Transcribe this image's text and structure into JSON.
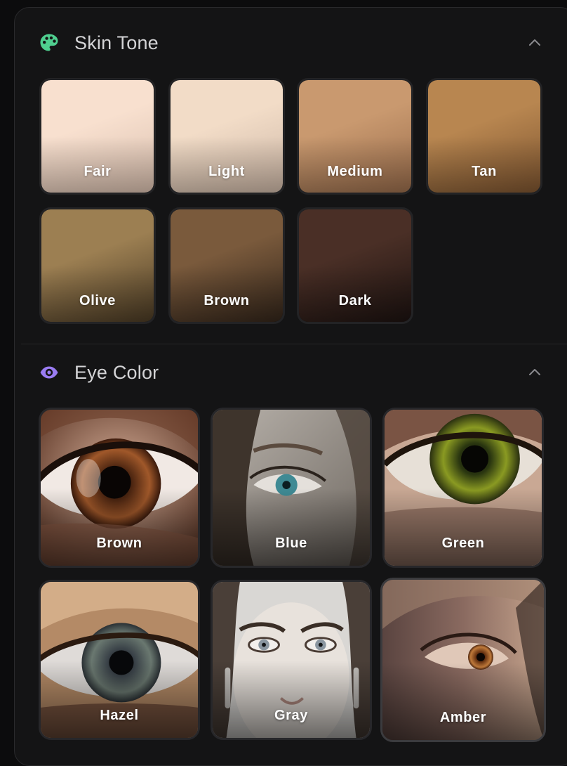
{
  "skin_section": {
    "title": "Skin Tone",
    "icon": "palette-icon",
    "icon_color": "#4fcf8f",
    "collapsed": false,
    "options": [
      {
        "label": "Fair",
        "color_top": "#f8e0cf",
        "color_bottom": "#d9bfae"
      },
      {
        "label": "Light",
        "color_top": "#f2dcc7",
        "color_bottom": "#cdb7a6"
      },
      {
        "label": "Medium",
        "color_top": "#c9996f",
        "color_bottom": "#9a6d4c"
      },
      {
        "label": "Tan",
        "color_top": "#b88650",
        "color_bottom": "#7e5530"
      },
      {
        "label": "Olive",
        "color_top": "#9c7f52",
        "color_bottom": "#4a3a24"
      },
      {
        "label": "Brown",
        "color_top": "#7a5a3c",
        "color_bottom": "#33251a"
      },
      {
        "label": "Dark",
        "color_top": "#4a2f26",
        "color_bottom": "#1c1210"
      }
    ]
  },
  "eye_section": {
    "title": "Eye Color",
    "icon": "eye-icon",
    "icon_color": "#9a7cf2",
    "collapsed": false,
    "options": [
      {
        "label": "Brown"
      },
      {
        "label": "Blue"
      },
      {
        "label": "Green"
      },
      {
        "label": "Hazel"
      },
      {
        "label": "Gray"
      },
      {
        "label": "Amber"
      }
    ]
  }
}
